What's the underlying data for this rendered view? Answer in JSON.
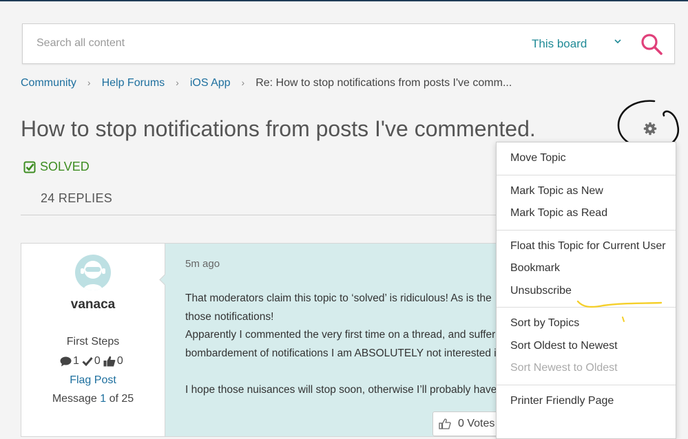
{
  "search": {
    "placeholder": "Search all content",
    "scope": "This board"
  },
  "breadcrumb": [
    {
      "label": "Community"
    },
    {
      "label": "Help Forums"
    },
    {
      "label": "iOS App"
    },
    {
      "label": "Re: How to stop notifications from posts I've comm..."
    }
  ],
  "topic": {
    "title": "How to stop notifications from posts I've commented.",
    "status": "SOLVED",
    "replies": "24 REPLIES"
  },
  "post": {
    "username": "vanaca",
    "rank": "First Steps",
    "stats": {
      "messages": "1",
      "solutions": "0",
      "kudos": "0"
    },
    "flag_label": "Flag Post",
    "message_prefix": "Message",
    "message_index": "1",
    "message_of": "of 25",
    "timestamp": "5m ago",
    "lines": [
      "That moderators claim this topic to ‘solved’ is ridiculous! As is the",
      "those notifications!",
      "Apparently I commented the very first time on a thread, and suffer",
      "bombardement of notifications I am ABSOLUTELY not interested i",
      "",
      "I hope those nuisances will stop soon, otherwise I’ll probably have"
    ],
    "votes_label": "0 Votes"
  },
  "menu": {
    "sections": [
      [
        {
          "label": "Move Topic",
          "enabled": true
        }
      ],
      [
        {
          "label": "Mark Topic as New",
          "enabled": true
        },
        {
          "label": "Mark Topic as Read",
          "enabled": true
        }
      ],
      [
        {
          "label": "Float this Topic for Current User",
          "enabled": true
        },
        {
          "label": "Bookmark",
          "enabled": true
        },
        {
          "label": "Unsubscribe",
          "enabled": true
        }
      ],
      [
        {
          "label": "Sort by Topics",
          "enabled": true
        },
        {
          "label": "Sort Oldest to Newest",
          "enabled": true
        },
        {
          "label": "Sort Newest to Oldest",
          "enabled": false
        }
      ],
      [
        {
          "label": "Printer Friendly Page",
          "enabled": true
        }
      ]
    ]
  },
  "colors": {
    "link": "#1d6f9e",
    "solved": "#3e8d22",
    "search_icon": "#e0407a",
    "post_bg": "#d6ecec",
    "annotation_yellow": "#f5cf2a"
  }
}
